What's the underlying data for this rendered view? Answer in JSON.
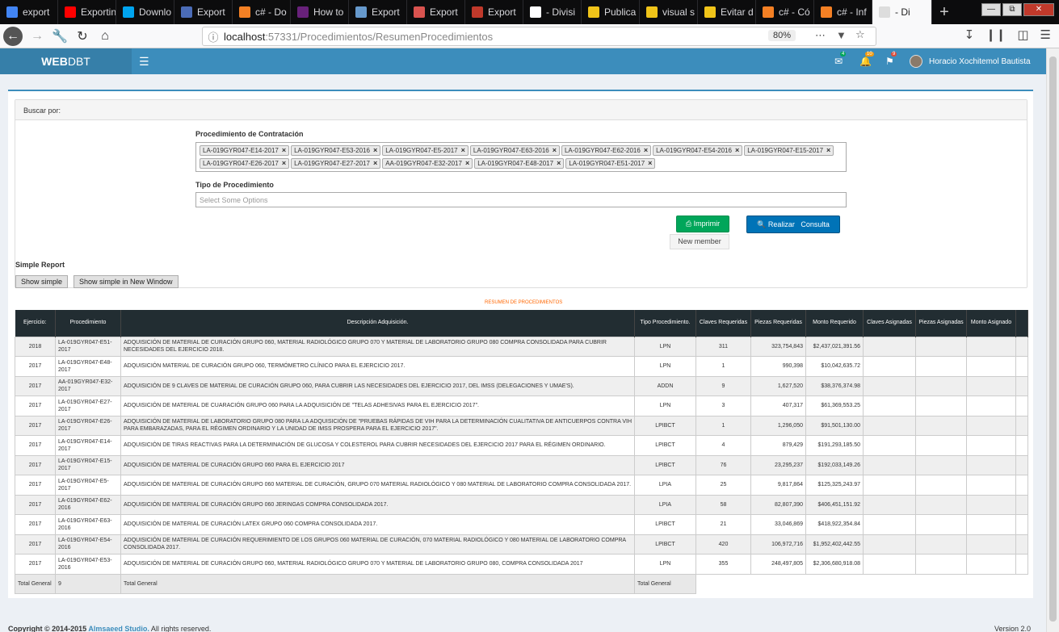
{
  "browser": {
    "tabs": [
      {
        "label": "export",
        "color": "#4285f4"
      },
      {
        "label": "Exportin",
        "color": "#ff0000"
      },
      {
        "label": "Downlo",
        "color": "#00a4ef"
      },
      {
        "label": "Export",
        "color": "#4b6cb7"
      },
      {
        "label": "c# - Do",
        "color": "#f48024"
      },
      {
        "label": "How to",
        "color": "#68217a"
      },
      {
        "label": "Export",
        "color": "#6699cc"
      },
      {
        "label": "Export",
        "color": "#d9534f"
      },
      {
        "label": "Export",
        "color": "#c0392b"
      },
      {
        "label": "- Divisi",
        "color": "#ffffff"
      },
      {
        "label": "Publica",
        "color": "#f0c419"
      },
      {
        "label": "visual s",
        "color": "#f0c419"
      },
      {
        "label": "Evitar d",
        "color": "#f0c419"
      },
      {
        "label": "c# - Có",
        "color": "#f48024"
      },
      {
        "label": "c# - Inf",
        "color": "#f48024"
      },
      {
        "label": "- Di",
        "color": "#dddddd"
      }
    ],
    "url_host": "localhost",
    "url_path": ":57331/Procedimientos/ResumenProcedimientos",
    "zoom": "80%"
  },
  "app": {
    "logo_bold": "WEB",
    "logo_rest": "DBT",
    "badges": {
      "mail": "4",
      "bell": "10",
      "flag": "9"
    },
    "badge_colors": {
      "mail": "#00a65a",
      "bell": "#f39c12",
      "flag": "#dd4b39"
    },
    "user_name": "Horacio Xochitemol Bautista"
  },
  "search": {
    "header": "Buscar por:",
    "procedimiento_label": "Procedimiento de Contratación",
    "chips": [
      "LA-019GYR047-E14-2017",
      "LA-019GYR047-E53-2016",
      "LA-019GYR047-E5-2017",
      "LA-019GYR047-E63-2016",
      "LA-019GYR047-E62-2016",
      "LA-019GYR047-E54-2016",
      "LA-019GYR047-E15-2017",
      "LA-019GYR047-E26-2017",
      "LA-019GYR047-E27-2017",
      "AA-019GYR047-E32-2017",
      "LA-019GYR047-E48-2017",
      "LA-019GYR047-E51-2017"
    ],
    "tipo_label": "Tipo de Procedimiento",
    "tipo_placeholder": "Select Some Options",
    "imprimir": "Imprimir",
    "consulta": "Realizar   Consulta",
    "new_member": "New member"
  },
  "simple": {
    "label": "Simple Report",
    "show_simple": "Show simple",
    "show_window": "Show simple in New Window"
  },
  "report": {
    "title": "RESUMEN DE PROCEDIMIENTOS",
    "headers": [
      "Ejercicio:",
      "Procedimiento",
      "Descripción Adquisición.",
      "Tipo Procedimiento.",
      "Claves Requeridas",
      "Piezas Requeridas",
      "Monto Requerido",
      "Claves Asignadas",
      "Piezas Asignadas",
      "Monto Asignado"
    ],
    "rows": [
      [
        "2018",
        "LA-019GYR047-E51-2017",
        "ADQUISICIÓN DE MATERIAL DE CURACIÓN GRUPO 060, MATERIAL RADIOLÓGICO GRUPO 070 Y MATERIAL DE LABORATORIO GRUPO 080 COMPRA CONSOLIDADA PARA CUBRIR NECESIDADES DEL EJERCICIO 2018.",
        "LPN",
        "311",
        "323,754,843",
        "$2,437,021,391.56"
      ],
      [
        "2017",
        "LA-019GYR047-E48-2017",
        "ADQUISICIÓN MATERIAL DE CURACIÓN GRUPO 060, TERMÓMETRO CLÍNICO PARA EL EJERCICIO 2017.",
        "LPN",
        "1",
        "990,398",
        "$10,042,635.72"
      ],
      [
        "2017",
        "AA-019GYR047-E32-2017",
        "ADQUISICIÓN DE 9 CLAVES DE MATERIAL DE CURACIÓN GRUPO 060, PARA CUBRIR LAS NECESIDADES DEL EJERCICIO 2017, DEL IMSS (DELEGACIONES Y UMAE'S).",
        "ADDN",
        "9",
        "1,627,520",
        "$38,376,374.98"
      ],
      [
        "2017",
        "LA-019GYR047-E27-2017",
        "ADQUISICIÓN DE MATERIAL DE CUARACIÓN GRUPO 060 PARA LA ADQUISICIÓN DE \"TELAS ADHESIVAS PARA EL EJERCICIO 2017\".",
        "LPN",
        "3",
        "407,317",
        "$61,369,553.25"
      ],
      [
        "2017",
        "LA-019GYR047-E26-2017",
        "ADQUISICIÓN DE MATERIAL DE LABORATORIO GRUPO 080 PARA LA ADQUISICIÓN DE \"PRUEBAS RÁPIDAS DE VIH PARA LA DETERMINACIÓN CUALITATIVA DE ANTICUERPOS CONTRA VIH PARA EMBARAZADAS, PARA EL RÉGIMEN ORDINARIO Y LA UNIDAD DE IMSS PROSPERA PARA EL EJERCICIO 2017\".",
        "LPIBCT",
        "1",
        "1,296,050",
        "$91,501,130.00"
      ],
      [
        "2017",
        "LA-019GYR047-E14-2017",
        "ADQUISICIÓN DE TIRAS REACTIVAS PARA LA DETERMINACIÓN DE GLUCOSA Y COLESTEROL PARA CUBRIR NECESIDADES DEL EJERCICIO 2017 PARA EL RÉGIMEN ORDINARIO.",
        "LPIBCT",
        "4",
        "879,429",
        "$191,293,185.50"
      ],
      [
        "2017",
        "LA-019GYR047-E15-2017",
        "ADQUISICIÓN DE MATERIAL DE CURACIÓN GRUPO 060 PARA EL EJERCICIO 2017",
        "LPIBCT",
        "76",
        "23,295,237",
        "$192,033,149.26"
      ],
      [
        "2017",
        "LA-019GYR047-E5-2017",
        "ADQUISICIÓN DE MATERIAL DE CURACIÓN GRUPO 060 MATERIAL DE CURACIÓN, GRUPO 070 MATERIAL RADIOLÓGICO Y 080 MATERIAL DE LABORATORIO COMPRA CONSOLIDADA 2017.",
        "LPIA",
        "25",
        "9,817,864",
        "$125,325,243.97"
      ],
      [
        "2017",
        "LA-019GYR047-E62-2016",
        "ADQUISICIÓN DE MATERIAL DE CURACIÓN GRUPO 060 JERINGAS COMPRA CONSOLIDADA 2017.",
        "LPIA",
        "58",
        "82,807,390",
        "$406,451,151.92"
      ],
      [
        "2017",
        "LA-019GYR047-E63-2016",
        "ADQUISICIÓN DE MATERIAL DE CURACIÓN LATEX GRUPO 060 COMPRA CONSOLIDADA 2017.",
        "LPIBCT",
        "21",
        "33,046,869",
        "$418,922,354.84"
      ],
      [
        "2017",
        "LA-019GYR047-E54-2016",
        "ADQUISICIÓN DE MATERIAL DE CURACIÓN REQUERIMIENTO DE LOS GRUPOS 060 MATERIAL DE CURACIÓN, 070 MATERIAL RADIOLÓGICO Y 080 MATERIAL DE LABORATORIO COMPRA CONSOLIDADA 2017.",
        "LPIBCT",
        "420",
        "106,972,716",
        "$1,952,402,442.55"
      ],
      [
        "2017",
        "LA-019GYR047-E53-2016",
        "ADQUISICIÓN DE MATERIAL DE CURACIÓN GRUPO 060, MATERIAL RADIOLÓGICO GRUPO 070 Y MATERIAL DE LABORATORIO GRUPO 080, COMPRA CONSOLIDADA 2017",
        "LPN",
        "355",
        "248,497,805",
        "$2,306,680,918.08"
      ]
    ],
    "total": {
      "label": "Total General",
      "count": "9",
      "desc": "Total General",
      "tipo": "Total General"
    }
  },
  "footer": {
    "prefix": "Copyright © 2014-2015 ",
    "brand": "Almsaeed Studio.",
    "suffix": " All rights reserved.",
    "version": "Version 2.0"
  }
}
